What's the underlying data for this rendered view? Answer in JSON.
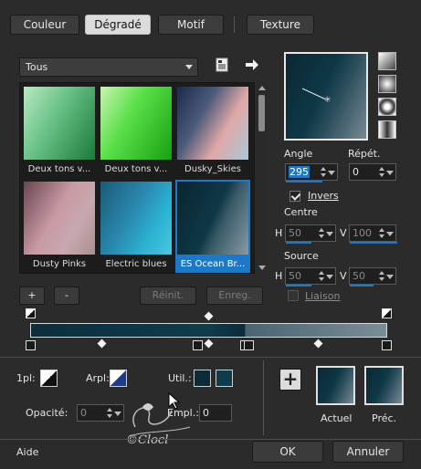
{
  "tabs": [
    {
      "label": "Couleur",
      "active": false
    },
    {
      "label": "Dégradé",
      "active": true
    },
    {
      "label": "Motif",
      "active": false
    },
    {
      "label": "Texture",
      "active": false
    }
  ],
  "category": {
    "selected": "Tous"
  },
  "gallery": {
    "items": [
      {
        "name": "Deux tons v...",
        "selected": false
      },
      {
        "name": "Deux tons v...",
        "selected": false
      },
      {
        "name": "Dusky_Skies",
        "selected": false
      },
      {
        "name": "Dusty Pinks",
        "selected": false
      },
      {
        "name": "Electric blues",
        "selected": false
      },
      {
        "name": "ES Ocean Br...",
        "selected": true
      }
    ]
  },
  "buttons": {
    "add": "+",
    "remove": "-",
    "reset": "Réinit.",
    "save": "Enreg.",
    "ok": "OK",
    "cancel": "Annuler",
    "help": "Aide"
  },
  "angle": {
    "label": "Angle",
    "value": "295"
  },
  "repeat": {
    "label": "Répét.",
    "value": "0"
  },
  "invert": {
    "label": "Invers",
    "checked": true
  },
  "center": {
    "label": "Centre",
    "h_label": "H",
    "h_value": "50",
    "v_label": "V",
    "v_value": "100"
  },
  "source": {
    "label": "Source",
    "h_label": "H",
    "h_value": "50",
    "v_label": "V",
    "v_value": "50"
  },
  "link": {
    "label": "Liaison",
    "checked": false
  },
  "editor": {
    "first_label": "1pl:",
    "bg_label": "Arpl:",
    "use_label": "Util.:",
    "opacity_label": "Opacité:",
    "opacity_value": "0",
    "location_label": "Empl.:",
    "location_value": "0"
  },
  "result": {
    "current_label": "Actuel",
    "previous_label": "Préc.",
    "add_symbol": "+"
  },
  "watermark": "©Clocl",
  "colors": {
    "accent": "#1e78c8",
    "gradient_dark": "#0c2733",
    "gradient_light": "#7a8a95"
  }
}
